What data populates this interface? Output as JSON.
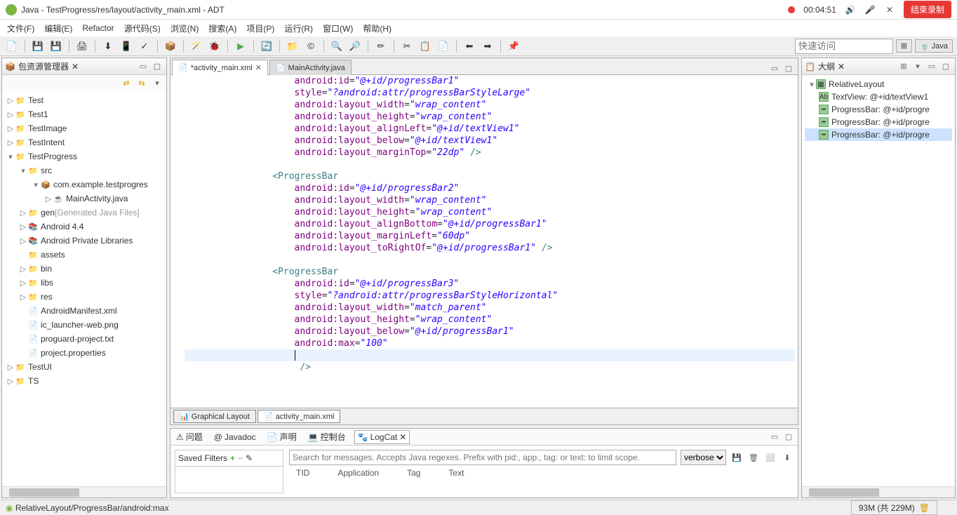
{
  "title": "Java  -  TestProgress/res/layout/activity_main.xml  -  ADT",
  "recording_time": "00:04:51",
  "end_recording": "结束录制",
  "menus": [
    "文件(F)",
    "编辑(E)",
    "Refactor",
    "源代码(S)",
    "浏览(N)",
    "搜索(A)",
    "项目(P)",
    "运行(R)",
    "窗口(W)",
    "帮助(H)"
  ],
  "quick_access_placeholder": "快速访问",
  "perspective": "Java",
  "explorer": {
    "title": "包资源管理器",
    "tree": [
      {
        "d": 0,
        "tw": "▷",
        "ico": "prj",
        "label": "Test"
      },
      {
        "d": 0,
        "tw": "▷",
        "ico": "prj",
        "label": "Test1"
      },
      {
        "d": 0,
        "tw": "▷",
        "ico": "prj",
        "label": "TestImage"
      },
      {
        "d": 0,
        "tw": "▷",
        "ico": "prj",
        "label": "TestIntent"
      },
      {
        "d": 0,
        "tw": "▾",
        "ico": "prj",
        "label": "TestProgress"
      },
      {
        "d": 1,
        "tw": "▾",
        "ico": "fld",
        "label": "src"
      },
      {
        "d": 2,
        "tw": "▾",
        "ico": "pkg",
        "label": "com.example.testprogres"
      },
      {
        "d": 3,
        "tw": "▷",
        "ico": "java",
        "label": "MainActivity.java"
      },
      {
        "d": 1,
        "tw": "▷",
        "ico": "fld",
        "label": "gen",
        "suffix": " [Generated Java Files]"
      },
      {
        "d": 1,
        "tw": "▷",
        "ico": "lib",
        "label": "Android 4.4"
      },
      {
        "d": 1,
        "tw": "▷",
        "ico": "lib",
        "label": "Android Private Libraries"
      },
      {
        "d": 1,
        "tw": "",
        "ico": "fld",
        "label": "assets"
      },
      {
        "d": 1,
        "tw": "▷",
        "ico": "fld",
        "label": "bin"
      },
      {
        "d": 1,
        "tw": "▷",
        "ico": "fld",
        "label": "libs"
      },
      {
        "d": 1,
        "tw": "▷",
        "ico": "fld",
        "label": "res"
      },
      {
        "d": 1,
        "tw": "",
        "ico": "file",
        "label": "AndroidManifest.xml"
      },
      {
        "d": 1,
        "tw": "",
        "ico": "file",
        "label": "ic_launcher-web.png"
      },
      {
        "d": 1,
        "tw": "",
        "ico": "file",
        "label": "proguard-project.txt"
      },
      {
        "d": 1,
        "tw": "",
        "ico": "file",
        "label": "project.properties"
      },
      {
        "d": 0,
        "tw": "▷",
        "ico": "prj",
        "label": "TestUI"
      },
      {
        "d": 0,
        "tw": "▷",
        "ico": "prj",
        "label": "TS"
      }
    ]
  },
  "editor": {
    "tabs": [
      {
        "label": "*activity_main.xml",
        "active": true,
        "dirty": true
      },
      {
        "label": "MainActivity.java",
        "active": false,
        "dirty": false
      }
    ],
    "bottom_tabs": {
      "graphical": "Graphical Layout",
      "xml": "activity_main.xml"
    },
    "code": [
      {
        "i": 5,
        "t": "attr",
        "a": "android:id",
        "v": "\"@+id/progressBar1\""
      },
      {
        "i": 5,
        "t": "attr",
        "a": "style",
        "v": "\"?android:attr/progressBarStyleLarge\""
      },
      {
        "i": 5,
        "t": "attr",
        "a": "android:layout_width",
        "v": "\"wrap_content\""
      },
      {
        "i": 5,
        "t": "attr",
        "a": "android:layout_height",
        "v": "\"wrap_content\""
      },
      {
        "i": 5,
        "t": "attr",
        "a": "android:layout_alignLeft",
        "v": "\"@+id/textView1\""
      },
      {
        "i": 5,
        "t": "attr",
        "a": "android:layout_below",
        "v": "\"@+id/textView1\""
      },
      {
        "i": 5,
        "t": "attrend",
        "a": "android:layout_marginTop",
        "v": "\"22dp\""
      },
      {
        "i": 0,
        "t": "blank"
      },
      {
        "i": 4,
        "t": "open",
        "tag": "ProgressBar"
      },
      {
        "i": 5,
        "t": "attr",
        "a": "android:id",
        "v": "\"@+id/progressBar2\""
      },
      {
        "i": 5,
        "t": "attr",
        "a": "android:layout_width",
        "v": "\"wrap_content\""
      },
      {
        "i": 5,
        "t": "attr",
        "a": "android:layout_height",
        "v": "\"wrap_content\""
      },
      {
        "i": 5,
        "t": "attr",
        "a": "android:layout_alignBottom",
        "v": "\"@+id/progressBar1\""
      },
      {
        "i": 5,
        "t": "attr",
        "a": "android:layout_marginLeft",
        "v": "\"60dp\""
      },
      {
        "i": 5,
        "t": "attrend",
        "a": "android:layout_toRightOf",
        "v": "\"@+id/progressBar1\""
      },
      {
        "i": 0,
        "t": "blank"
      },
      {
        "i": 4,
        "t": "open",
        "tag": "ProgressBar"
      },
      {
        "i": 5,
        "t": "attr",
        "a": "android:id",
        "v": "\"@+id/progressBar3\""
      },
      {
        "i": 5,
        "t": "attr",
        "a": "style",
        "v": "\"?android:attr/progressBarStyleHorizontal\""
      },
      {
        "i": 5,
        "t": "attr",
        "a": "android:layout_width",
        "v": "\"match_parent\""
      },
      {
        "i": 5,
        "t": "attr",
        "a": "android:layout_height",
        "v": "\"wrap_content\""
      },
      {
        "i": 5,
        "t": "attr",
        "a": "android:layout_below",
        "v": "\"@+id/progressBar1\""
      },
      {
        "i": 5,
        "t": "attr",
        "a": "android:max",
        "v": "\"100\""
      },
      {
        "i": 5,
        "t": "cursor"
      },
      {
        "i": 5,
        "t": "plain",
        "text": " />"
      }
    ]
  },
  "outline": {
    "title": "大纲",
    "items": [
      {
        "d": 0,
        "ico": "rl",
        "tw": "▾",
        "label": "RelativeLayout"
      },
      {
        "d": 1,
        "ico": "tv",
        "label": "TextView: @+id/textView1"
      },
      {
        "d": 1,
        "ico": "pb",
        "label": "ProgressBar: @+id/progre"
      },
      {
        "d": 1,
        "ico": "pb",
        "label": "ProgressBar: @+id/progre"
      },
      {
        "d": 1,
        "ico": "pb",
        "label": "ProgressBar: @+id/progre",
        "sel": true
      }
    ]
  },
  "bottom": {
    "tabs": [
      {
        "label": "问题",
        "ico": "⚠"
      },
      {
        "label": "Javadoc",
        "ico": "@"
      },
      {
        "label": "声明",
        "ico": "📄"
      },
      {
        "label": "控制台",
        "ico": "💻"
      },
      {
        "label": "LogCat",
        "ico": "🐾",
        "active": true
      }
    ],
    "saved_filters": "Saved Filters",
    "search_placeholder": "Search for messages. Accepts Java regexes. Prefix with pid:, app:, tag: or text: to limit scope.",
    "level": "verbose",
    "columns": [
      "TID",
      "Application",
      "Tag",
      "Text"
    ]
  },
  "status": {
    "path": "RelativeLayout/ProgressBar/android:max",
    "heap": "93M  (共 229M)"
  }
}
